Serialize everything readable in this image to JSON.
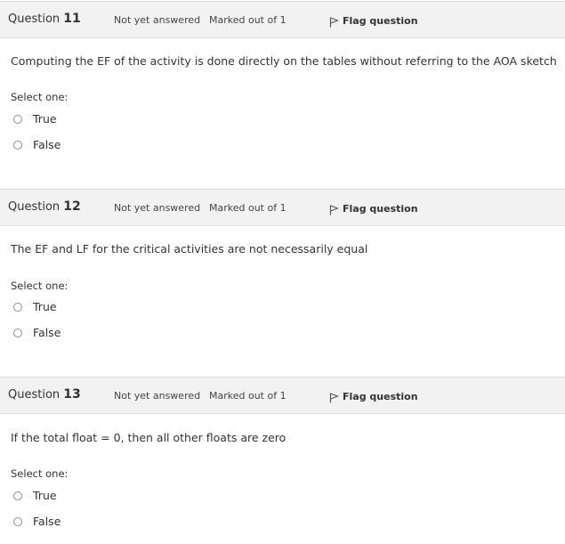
{
  "questions": [
    {
      "label": "Question",
      "number": "11",
      "state": "Not yet answered",
      "grade": "Marked out of 1",
      "flag_label": "Flag question",
      "text": "Computing the EF of the activity is done directly on the tables without referring to the AOA sketch",
      "prompt": "Select one:",
      "options": [
        "True",
        "False"
      ]
    },
    {
      "label": "Question",
      "number": "12",
      "state": "Not yet answered",
      "grade": "Marked out of 1",
      "flag_label": "Flag question",
      "text": "The EF and LF for the critical activities are not necessarily equal",
      "prompt": "Select one:",
      "options": [
        "True",
        "False"
      ]
    },
    {
      "label": "Question",
      "number": "13",
      "state": "Not yet answered",
      "grade": "Marked out of 1",
      "flag_label": "Flag question",
      "text": "If the total float = 0, then all other floats are zero",
      "prompt": "Select one:",
      "options": [
        "True",
        "False"
      ]
    }
  ],
  "colors": {
    "header_bg": "#f2f2f2",
    "border": "#dcdcdc",
    "text": "#333333"
  },
  "icons": {
    "flag": "flag-outline-icon",
    "radio": "radio-unchecked"
  }
}
